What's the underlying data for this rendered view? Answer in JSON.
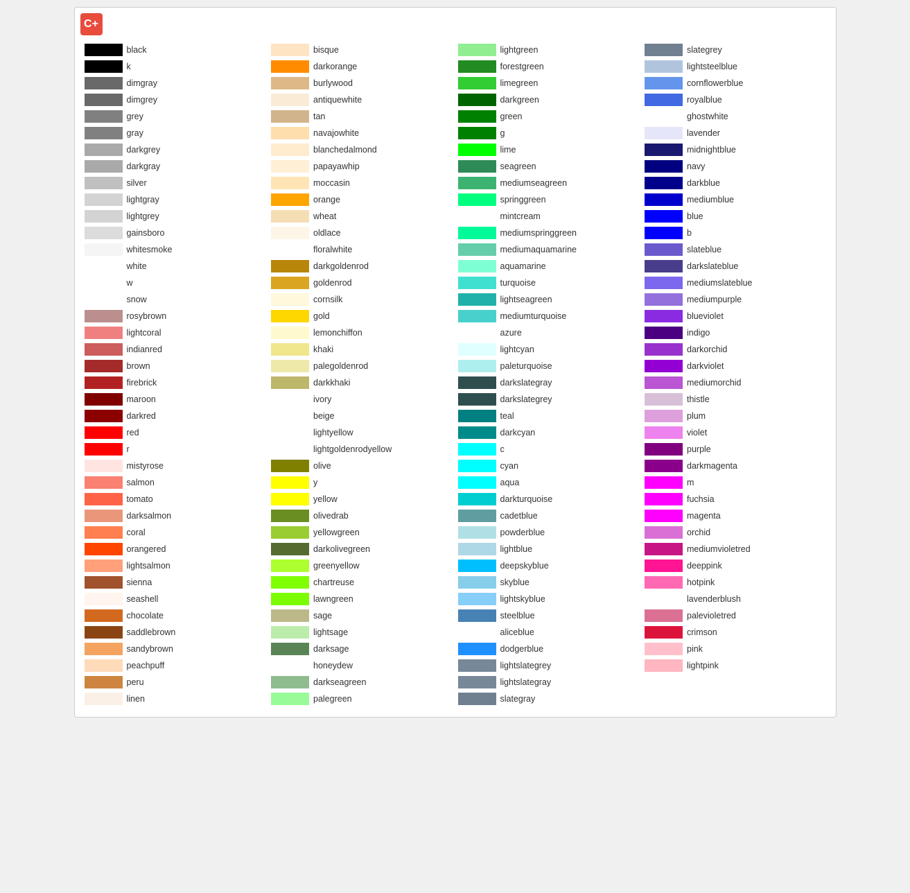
{
  "logo": {
    "symbol": "C+"
  },
  "columns": [
    {
      "items": [
        {
          "name": "black",
          "color": "#000000"
        },
        {
          "name": "k",
          "color": "#000000"
        },
        {
          "name": "dimgray",
          "color": "#696969"
        },
        {
          "name": "dimgrey",
          "color": "#696969"
        },
        {
          "name": "grey",
          "color": "#808080"
        },
        {
          "name": "gray",
          "color": "#808080"
        },
        {
          "name": "darkgrey",
          "color": "#a9a9a9"
        },
        {
          "name": "darkgray",
          "color": "#a9a9a9"
        },
        {
          "name": "silver",
          "color": "#c0c0c0"
        },
        {
          "name": "lightgray",
          "color": "#d3d3d3"
        },
        {
          "name": "lightgrey",
          "color": "#d3d3d3"
        },
        {
          "name": "gainsboro",
          "color": "#dcdcdc"
        },
        {
          "name": "whitesmoke",
          "color": "#f5f5f5"
        },
        {
          "name": "white",
          "color": null
        },
        {
          "name": "w",
          "color": null
        },
        {
          "name": "snow",
          "color": null
        },
        {
          "name": "rosybrown",
          "color": "#bc8f8f"
        },
        {
          "name": "lightcoral",
          "color": "#f08080"
        },
        {
          "name": "indianred",
          "color": "#cd5c5c"
        },
        {
          "name": "brown",
          "color": "#a52a2a"
        },
        {
          "name": "firebrick",
          "color": "#b22222"
        },
        {
          "name": "maroon",
          "color": "#800000"
        },
        {
          "name": "darkred",
          "color": "#8b0000"
        },
        {
          "name": "red",
          "color": "#ff0000"
        },
        {
          "name": "r",
          "color": "#ff0000"
        },
        {
          "name": "mistyrose",
          "color": "#ffe4e1"
        },
        {
          "name": "salmon",
          "color": "#fa8072"
        },
        {
          "name": "tomato",
          "color": "#ff6347"
        },
        {
          "name": "darksalmon",
          "color": "#e9967a"
        },
        {
          "name": "coral",
          "color": "#ff7f50"
        },
        {
          "name": "orangered",
          "color": "#ff4500"
        },
        {
          "name": "lightsalmon",
          "color": "#ffa07a"
        },
        {
          "name": "sienna",
          "color": "#a0522d"
        },
        {
          "name": "seashell",
          "color": "#fff5ee"
        },
        {
          "name": "chocolate",
          "color": "#d2691e"
        },
        {
          "name": "saddlebrown",
          "color": "#8b4513"
        },
        {
          "name": "sandybrown",
          "color": "#f4a460"
        },
        {
          "name": "peachpuff",
          "color": "#ffdab9"
        },
        {
          "name": "peru",
          "color": "#cd853f"
        },
        {
          "name": "linen",
          "color": "#faf0e6"
        }
      ]
    },
    {
      "items": [
        {
          "name": "bisque",
          "color": "#ffe4c4"
        },
        {
          "name": "darkorange",
          "color": "#ff8c00"
        },
        {
          "name": "burlywood",
          "color": "#deb887"
        },
        {
          "name": "antiquewhite",
          "color": "#faebd7"
        },
        {
          "name": "tan",
          "color": "#d2b48c"
        },
        {
          "name": "navajowhite",
          "color": "#ffdead"
        },
        {
          "name": "blanchedalmond",
          "color": "#ffebcd"
        },
        {
          "name": "papayawhip",
          "color": "#ffefd5"
        },
        {
          "name": "moccasin",
          "color": "#ffe4b5"
        },
        {
          "name": "orange",
          "color": "#ffa500"
        },
        {
          "name": "wheat",
          "color": "#f5deb3"
        },
        {
          "name": "oldlace",
          "color": "#fdf5e6"
        },
        {
          "name": "floralwhite",
          "color": null
        },
        {
          "name": "darkgoldenrod",
          "color": "#b8860b"
        },
        {
          "name": "goldenrod",
          "color": "#daa520"
        },
        {
          "name": "cornsilk",
          "color": "#fff8dc"
        },
        {
          "name": "gold",
          "color": "#ffd700"
        },
        {
          "name": "lemonchiffon",
          "color": "#fffacd"
        },
        {
          "name": "khaki",
          "color": "#f0e68c"
        },
        {
          "name": "palegoldenrod",
          "color": "#eee8aa"
        },
        {
          "name": "darkkhaki",
          "color": "#bdb76b"
        },
        {
          "name": "ivory",
          "color": null
        },
        {
          "name": "beige",
          "color": null
        },
        {
          "name": "lightyellow",
          "color": null
        },
        {
          "name": "lightgoldenrodyellow",
          "color": null
        },
        {
          "name": "olive",
          "color": "#808000"
        },
        {
          "name": "y",
          "color": "#ffff00"
        },
        {
          "name": "yellow",
          "color": "#ffff00"
        },
        {
          "name": "olivedrab",
          "color": "#6b8e23"
        },
        {
          "name": "yellowgreen",
          "color": "#9acd32"
        },
        {
          "name": "darkolivegreen",
          "color": "#556b2f"
        },
        {
          "name": "greenyellow",
          "color": "#adff2f"
        },
        {
          "name": "chartreuse",
          "color": "#7fff00"
        },
        {
          "name": "lawngreen",
          "color": "#7cfc00"
        },
        {
          "name": "sage",
          "color": "#bcb88a"
        },
        {
          "name": "lightsage",
          "color": "#bcecac"
        },
        {
          "name": "darksage",
          "color": "#598556"
        },
        {
          "name": "honeydew",
          "color": null
        },
        {
          "name": "darkseagreen",
          "color": "#8fbc8f"
        },
        {
          "name": "palegreen",
          "color": "#98fb98"
        }
      ]
    },
    {
      "items": [
        {
          "name": "lightgreen",
          "color": "#90ee90"
        },
        {
          "name": "forestgreen",
          "color": "#228b22"
        },
        {
          "name": "limegreen",
          "color": "#32cd32"
        },
        {
          "name": "darkgreen",
          "color": "#006400"
        },
        {
          "name": "green",
          "color": "#008000"
        },
        {
          "name": "g",
          "color": "#008000"
        },
        {
          "name": "lime",
          "color": "#00ff00"
        },
        {
          "name": "seagreen",
          "color": "#2e8b57"
        },
        {
          "name": "mediumseagreen",
          "color": "#3cb371"
        },
        {
          "name": "springgreen",
          "color": "#00ff7f"
        },
        {
          "name": "mintcream",
          "color": null
        },
        {
          "name": "mediumspringgreen",
          "color": "#00fa9a"
        },
        {
          "name": "mediumaquamarine",
          "color": "#66cdaa"
        },
        {
          "name": "aquamarine",
          "color": "#7fffd4"
        },
        {
          "name": "turquoise",
          "color": "#40e0d0"
        },
        {
          "name": "lightseagreen",
          "color": "#20b2aa"
        },
        {
          "name": "mediumturquoise",
          "color": "#48d1cc"
        },
        {
          "name": "azure",
          "color": null
        },
        {
          "name": "lightcyan",
          "color": "#e0ffff"
        },
        {
          "name": "paleturquoise",
          "color": "#afeeee"
        },
        {
          "name": "darkslategray",
          "color": "#2f4f4f"
        },
        {
          "name": "darkslategrey",
          "color": "#2f4f4f"
        },
        {
          "name": "teal",
          "color": "#008080"
        },
        {
          "name": "darkcyan",
          "color": "#008b8b"
        },
        {
          "name": "c",
          "color": "#00ffff"
        },
        {
          "name": "cyan",
          "color": "#00ffff"
        },
        {
          "name": "aqua",
          "color": "#00ffff"
        },
        {
          "name": "darkturquoise",
          "color": "#00ced1"
        },
        {
          "name": "cadetblue",
          "color": "#5f9ea0"
        },
        {
          "name": "powderblue",
          "color": "#b0e0e6"
        },
        {
          "name": "lightblue",
          "color": "#add8e6"
        },
        {
          "name": "deepskyblue",
          "color": "#00bfff"
        },
        {
          "name": "skyblue",
          "color": "#87ceeb"
        },
        {
          "name": "lightskyblue",
          "color": "#87cefa"
        },
        {
          "name": "steelblue",
          "color": "#4682b4"
        },
        {
          "name": "aliceblue",
          "color": null
        },
        {
          "name": "dodgerblue",
          "color": "#1e90ff"
        },
        {
          "name": "lightslategrey",
          "color": "#778899"
        },
        {
          "name": "lightslategray",
          "color": "#778899"
        },
        {
          "name": "slategray",
          "color": "#708090"
        }
      ]
    },
    {
      "items": [
        {
          "name": "slategrey",
          "color": "#708090"
        },
        {
          "name": "lightsteelblue",
          "color": "#b0c4de"
        },
        {
          "name": "cornflowerblue",
          "color": "#6495ed"
        },
        {
          "name": "royalblue",
          "color": "#4169e1"
        },
        {
          "name": "ghostwhite",
          "color": null
        },
        {
          "name": "lavender",
          "color": "#e6e6fa"
        },
        {
          "name": "midnightblue",
          "color": "#191970"
        },
        {
          "name": "navy",
          "color": "#000080"
        },
        {
          "name": "darkblue",
          "color": "#00008b"
        },
        {
          "name": "mediumblue",
          "color": "#0000cd"
        },
        {
          "name": "blue",
          "color": "#0000ff"
        },
        {
          "name": "b",
          "color": "#0000ff"
        },
        {
          "name": "slateblue",
          "color": "#6a5acd"
        },
        {
          "name": "darkslateblue",
          "color": "#483d8b"
        },
        {
          "name": "mediumslateblue",
          "color": "#7b68ee"
        },
        {
          "name": "mediumpurple",
          "color": "#9370db"
        },
        {
          "name": "blueviolet",
          "color": "#8a2be2"
        },
        {
          "name": "indigo",
          "color": "#4b0082"
        },
        {
          "name": "darkorchid",
          "color": "#9932cc"
        },
        {
          "name": "darkviolet",
          "color": "#9400d3"
        },
        {
          "name": "mediumorchid",
          "color": "#ba55d3"
        },
        {
          "name": "thistle",
          "color": "#d8bfd8"
        },
        {
          "name": "plum",
          "color": "#dda0dd"
        },
        {
          "name": "violet",
          "color": "#ee82ee"
        },
        {
          "name": "purple",
          "color": "#800080"
        },
        {
          "name": "darkmagenta",
          "color": "#8b008b"
        },
        {
          "name": "m",
          "color": "#ff00ff"
        },
        {
          "name": "fuchsia",
          "color": "#ff00ff"
        },
        {
          "name": "magenta",
          "color": "#ff00ff"
        },
        {
          "name": "orchid",
          "color": "#da70d6"
        },
        {
          "name": "mediumvioletred",
          "color": "#c71585"
        },
        {
          "name": "deeppink",
          "color": "#ff1493"
        },
        {
          "name": "hotpink",
          "color": "#ff69b4"
        },
        {
          "name": "lavenderblush",
          "color": null
        },
        {
          "name": "palevioletred",
          "color": "#db7093"
        },
        {
          "name": "crimson",
          "color": "#dc143c"
        },
        {
          "name": "pink",
          "color": "#ffc0cb"
        },
        {
          "name": "lightpink",
          "color": "#ffb6c1"
        }
      ]
    }
  ]
}
